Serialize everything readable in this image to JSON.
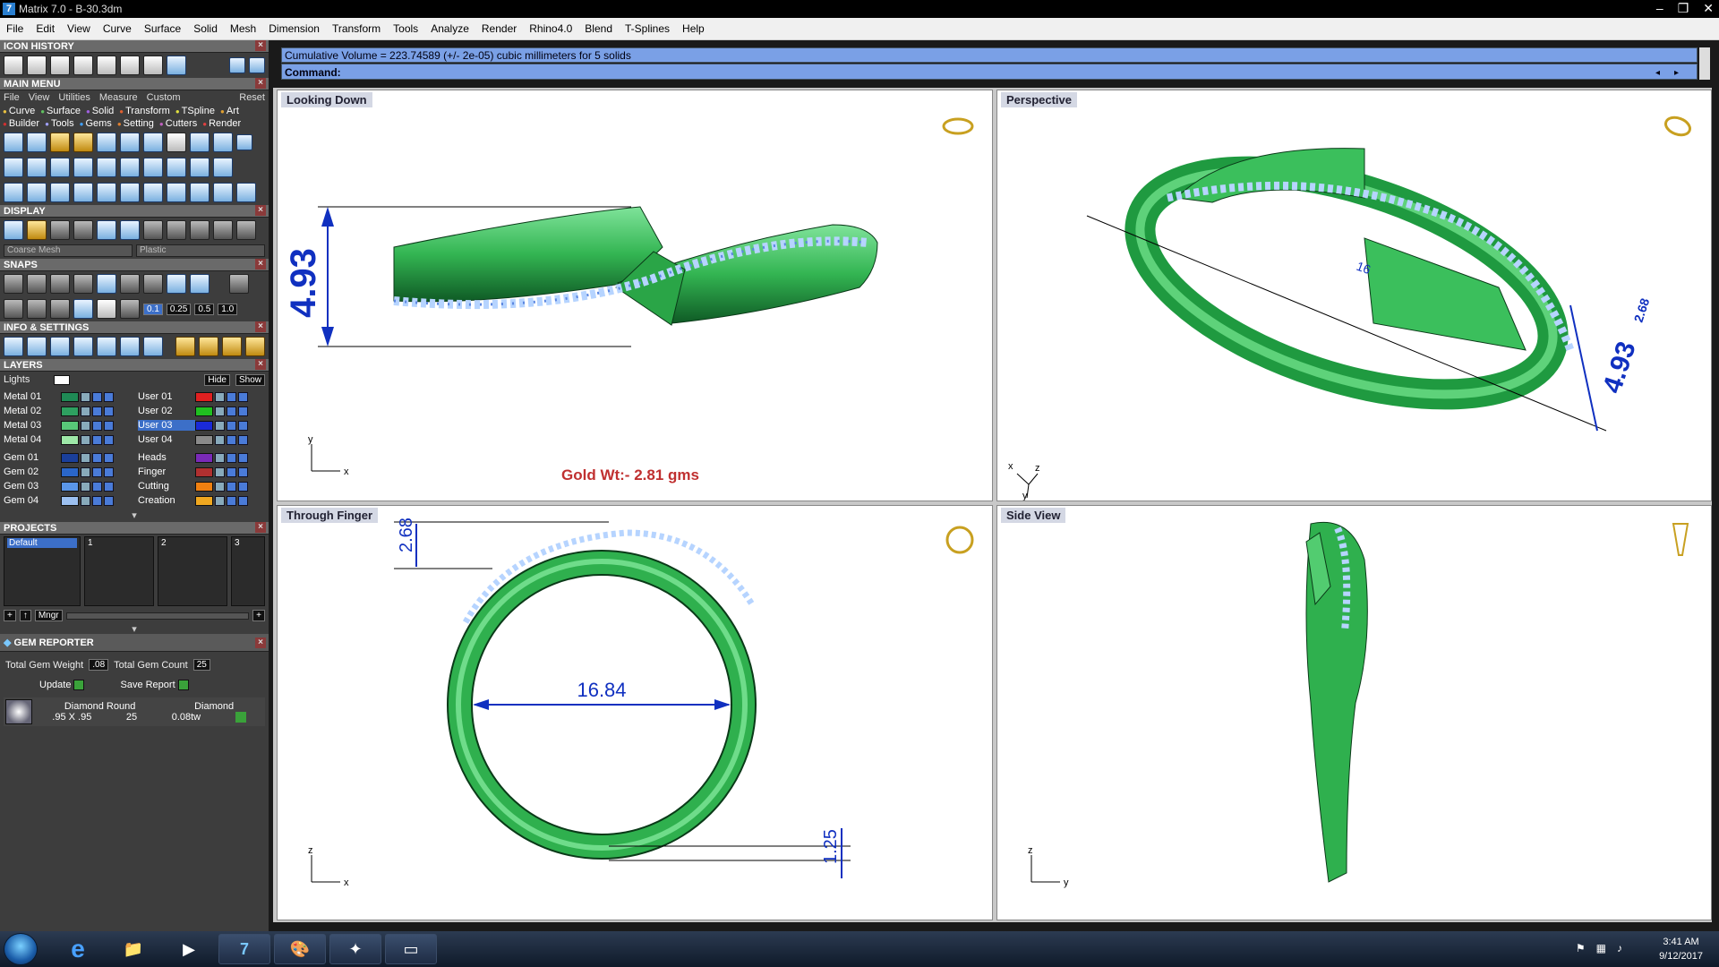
{
  "window": {
    "title": "Matrix 7.0 - B-30.3dm",
    "icon": "matrix-app-icon"
  },
  "menubar": [
    "File",
    "Edit",
    "View",
    "Curve",
    "Surface",
    "Solid",
    "Mesh",
    "Dimension",
    "Transform",
    "Tools",
    "Analyze",
    "Render",
    "Rhino4.0",
    "Blend",
    "T-Splines",
    "Help"
  ],
  "panels": {
    "icon_history": {
      "title": "ICON HISTORY"
    },
    "main_menu": {
      "title": "MAIN MENU",
      "submenu": [
        "File",
        "View",
        "Utilities",
        "Measure",
        "Custom",
        "Reset"
      ],
      "categories_row1": [
        "Curve",
        "Surface",
        "Solid",
        "Transform",
        "TSpline",
        "Art"
      ],
      "categories_row2": [
        "Builder",
        "Tools",
        "Gems",
        "Setting",
        "Cutters",
        "Render"
      ]
    },
    "display": {
      "title": "DISPLAY",
      "mesh_select": "Coarse Mesh",
      "material_select": "Plastic"
    },
    "snaps": {
      "title": "SNAPS",
      "tolerances": [
        "0.1",
        "0.25",
        "0.5",
        "1.0"
      ]
    },
    "info_settings": {
      "title": "INFO & SETTINGS"
    },
    "layers": {
      "title": "LAYERS",
      "lights_label": "Lights",
      "hide_label": "Hide",
      "show_label": "Show",
      "left": [
        {
          "name": "Metal 01",
          "color": "#1f8a55"
        },
        {
          "name": "Metal 02",
          "color": "#2ea060"
        },
        {
          "name": "Metal 03",
          "color": "#58c878"
        },
        {
          "name": "Metal 04",
          "color": "#9ee8a8"
        },
        {
          "name": "Gem 01",
          "color": "#1a3f9a"
        },
        {
          "name": "Gem 02",
          "color": "#2a66c8"
        },
        {
          "name": "Gem 03",
          "color": "#5a96e8"
        },
        {
          "name": "Gem 04",
          "color": "#9cc0f0"
        }
      ],
      "right": [
        {
          "name": "User 01",
          "color": "#e02020"
        },
        {
          "name": "User 02",
          "color": "#20c020"
        },
        {
          "name": "User 03",
          "color": "#1a2ad8",
          "selected": true
        },
        {
          "name": "User 04",
          "color": "#8a8a8a"
        },
        {
          "name": "Heads",
          "color": "#7a2ab8"
        },
        {
          "name": "Finger",
          "color": "#b03030"
        },
        {
          "name": "Cutting",
          "color": "#f08010"
        },
        {
          "name": "Creation",
          "color": "#f0a820"
        }
      ]
    },
    "projects": {
      "title": "PROJECTS",
      "default": "Default",
      "slots": [
        "1",
        "2",
        "3"
      ],
      "mngr": "Mngr"
    },
    "gem_reporter": {
      "title": "GEM REPORTER",
      "total_weight_label": "Total Gem Weight",
      "total_weight": ".08",
      "total_count_label": "Total Gem Count",
      "total_count": "25",
      "update": "Update",
      "save_report": "Save Report",
      "row": {
        "shape": "Diamond Round",
        "type": "Diamond",
        "size": ".95 X .95",
        "count": "25",
        "weight": "0.08tw"
      }
    }
  },
  "command": {
    "output": "Cumulative Volume = 223.74589 (+/- 2e-05) cubic millimeters for 5 solids",
    "prompt": "Command:"
  },
  "viewports": {
    "top_left": {
      "label": "Looking Down",
      "dimension": "4.93",
      "annotation": "Gold Wt:- 2.81 gms",
      "axis_x": "x",
      "axis_y": "y"
    },
    "top_right": {
      "label": "Perspective",
      "dim1": "4.93",
      "dim2": "2.68",
      "dim3": "16",
      "axis_x": "x",
      "axis_y": "y",
      "axis_z": "z"
    },
    "bottom_left": {
      "label": "Through Finger",
      "dim_top": "2.68",
      "dim_inner": "16.84",
      "dim_bottom": "1.25",
      "axis_x": "x",
      "axis_z": "z"
    },
    "bottom_right": {
      "label": "Side View",
      "axis_y": "y",
      "axis_z": "z"
    }
  },
  "taskbar": {
    "time": "3:41 AM",
    "date": "9/12/2017"
  },
  "colors": {
    "metal": "#3bbf5c",
    "metal_dark": "#1e7a36",
    "gem": "#8ab4f0",
    "dim_blue": "#1030c0",
    "annot_red": "#c03030"
  }
}
